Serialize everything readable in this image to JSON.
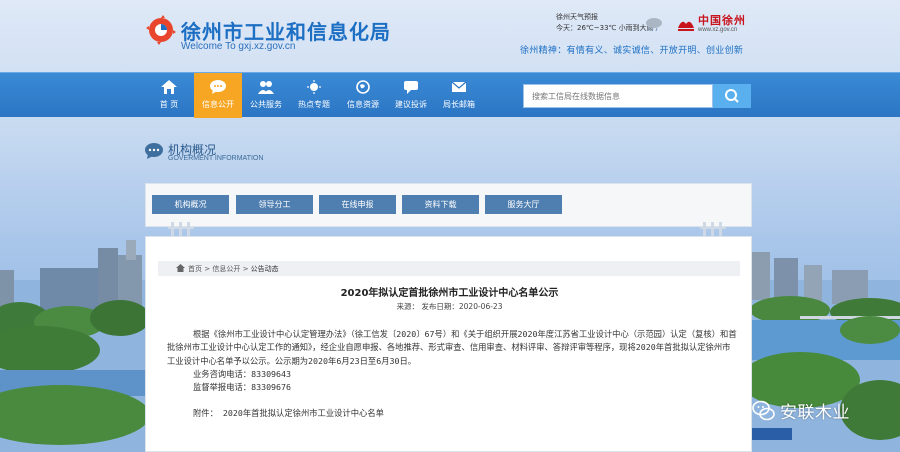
{
  "header": {
    "site_title": "徐州市工业和信息化局",
    "site_sub": "Welcome To gxj.xz.gov.cn",
    "weather_line1": "徐州天气预报",
    "weather_line2": "今天：26℃~33℃ 小雨到大雨",
    "china_logo_text": "中国徐州",
    "china_logo_url": "www.xz.gov.cn",
    "spirit": "徐州精神：有情有义、诚实诚信、开放开明、创业创新"
  },
  "nav": {
    "items": [
      {
        "label": "首 页",
        "icon": "home-icon"
      },
      {
        "label": "信息公开",
        "icon": "chat-icon"
      },
      {
        "label": "公共服务",
        "icon": "users-icon"
      },
      {
        "label": "热点专题",
        "icon": "sun-icon"
      },
      {
        "label": "信息资源",
        "icon": "globe-icon"
      },
      {
        "label": "建议投诉",
        "icon": "comment-icon"
      },
      {
        "label": "局长邮箱",
        "icon": "mail-icon"
      }
    ],
    "active_index": 1,
    "search_placeholder": "搜索工信局在线数据信息",
    "accent": "#f6a623"
  },
  "section": {
    "title": "机构概况",
    "subtitle": "GOVERMENT INFORMATION"
  },
  "submenu": {
    "items": [
      "机构概况",
      "领导分工",
      "在线申报",
      "资料下载",
      "服务大厅"
    ]
  },
  "article": {
    "breadcrumb": [
      "首页",
      "信息公开",
      "公告动态"
    ],
    "title": "2020年拟认定首批徐州市工业设计中心名单公示",
    "meta": "来源： 发布日期：2020-06-23",
    "para1": "根据《徐州市工业设计中心认定管理办法》（徐工信发〔2020〕67号）和《关于组织开展2020年度江苏省工业设计中心（示范园）认定（复核）和首批徐州市工业设计中心认定工作的通知》，经企业自愿申报、各地推荐、形式审查、信用审查、材料评审、答辩评审等程序，现将2020年首批拟认定徐州市工业设计中心名单予以公示。公示期为2020年6月23日至6月30日。",
    "phone1": "业务咨询电话：83309643",
    "phone2": "监督举报电话：83309676",
    "attachment": "附件：  2020年首批拟认定徐州市工业设计中心名单"
  },
  "watermark": {
    "text": "安联木业"
  }
}
